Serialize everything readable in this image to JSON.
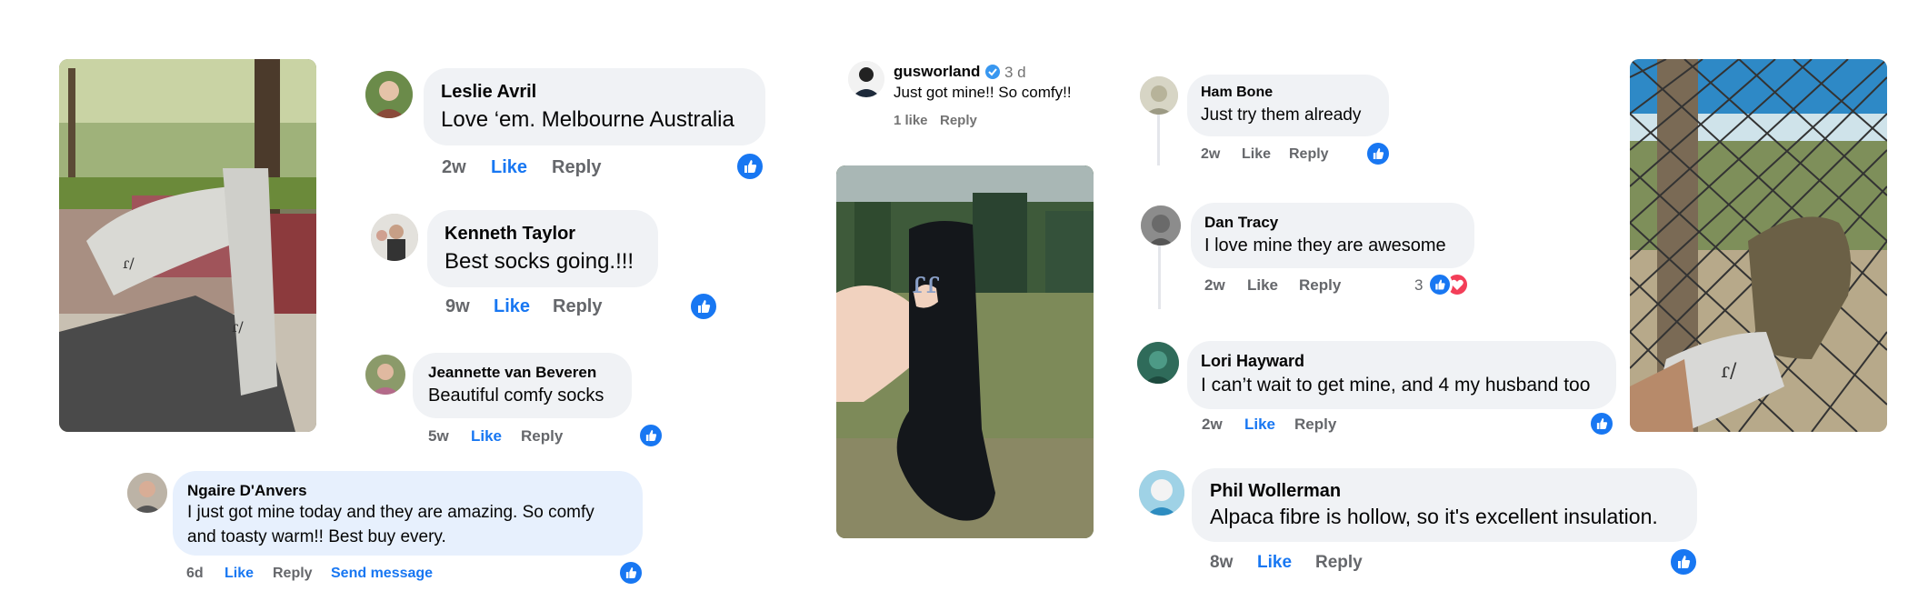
{
  "comments": [
    {
      "id": "leslie",
      "name": "Leslie Avril",
      "text": "Love ‘em. Melbourne Australia",
      "time": "2w",
      "like": "Like",
      "reply": "Reply"
    },
    {
      "id": "kenneth",
      "name": "Kenneth Taylor",
      "text": "Best socks going.!!!",
      "time": "9w",
      "like": "Like",
      "reply": "Reply"
    },
    {
      "id": "jeannette",
      "name": "Jeannette van Beveren",
      "text": "Beautiful comfy socks",
      "time": "5w",
      "like": "Like",
      "reply": "Reply"
    },
    {
      "id": "ngaire",
      "name": "Ngaire D'Anvers",
      "text_lines": [
        "I just got mine today and they are amazing. So comfy",
        "and toasty warm!! Best buy every."
      ],
      "time": "6d",
      "like": "Like",
      "reply": "Reply",
      "send": "Send message"
    },
    {
      "id": "ham",
      "name": "Ham Bone",
      "text": "Just try them already",
      "time": "2w",
      "like": "Like",
      "reply": "Reply"
    },
    {
      "id": "dan",
      "name": "Dan Tracy",
      "text": "I love mine they are awesome",
      "time": "2w",
      "like": "Like",
      "reply": "Reply",
      "reaction_count": "3"
    },
    {
      "id": "lori",
      "name": "Lori Hayward",
      "text": "I can’t wait to get mine, and 4 my husband too",
      "time": "2w",
      "like": "Like",
      "reply": "Reply"
    },
    {
      "id": "phil",
      "name": "Phil Wollerman",
      "text": "Alpaca fibre is hollow, so it's excellent insulation.",
      "time": "8w",
      "like": "Like",
      "reply": "Reply"
    }
  ],
  "instagram": {
    "username": "gusworland",
    "time": "3 d",
    "text": "Just got mine!! So comfy!!",
    "likes": "1 like",
    "reply": "Reply"
  },
  "colors": {
    "accent": "#1877f2",
    "bubble": "#f0f2f5",
    "bubble_highlight": "#e7f0fd",
    "meta_text": "#65676b",
    "heart": "#f33e58"
  },
  "icons": [
    "thumbs-up-reaction-icon",
    "heart-reaction-icon",
    "verified-badge-icon"
  ]
}
